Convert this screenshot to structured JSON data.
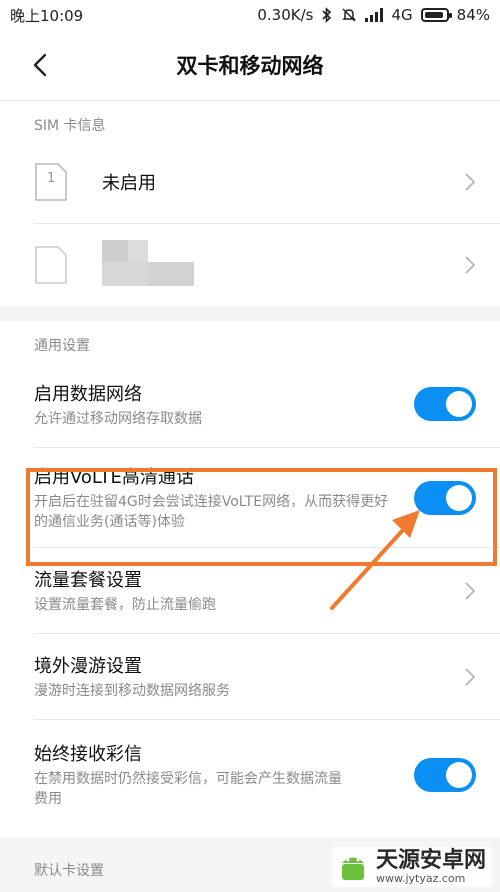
{
  "status_bar": {
    "time": "晚上10:09",
    "network_speed": "0.30K/s",
    "signal": "4G",
    "battery": "84%"
  },
  "header": {
    "title": "双卡和移动网络"
  },
  "sim_section": {
    "label": "SIM 卡信息",
    "sim1": {
      "slot": "1",
      "title": "未启用"
    }
  },
  "general_section": {
    "label": "通用设置",
    "items": [
      {
        "title": "启用数据网络",
        "subtitle": "允许通过移动网络存取数据",
        "enabled": true
      },
      {
        "title": "启用VoLTE高清通话",
        "subtitle": "开启后在驻留4G时会尝试连接VoLTE网络，从而获得更好的通信业务(通话等)体验",
        "enabled": true
      },
      {
        "title": "流量套餐设置",
        "subtitle": "设置流量套餐，防止流量偷跑"
      },
      {
        "title": "境外漫游设置",
        "subtitle": "漫游时连接到移动数据网络服务"
      },
      {
        "title": "始终接收彩信",
        "subtitle": "在禁用数据时仍然接受彩信，可能会产生数据流量费用",
        "enabled": true
      }
    ]
  },
  "default_section": {
    "label": "默认卡设置"
  },
  "watermark": {
    "name": "天源安卓网",
    "url": "www.jytyaz.com"
  },
  "colors": {
    "accent": "#0c8ff2",
    "highlight": "#f07a30"
  }
}
